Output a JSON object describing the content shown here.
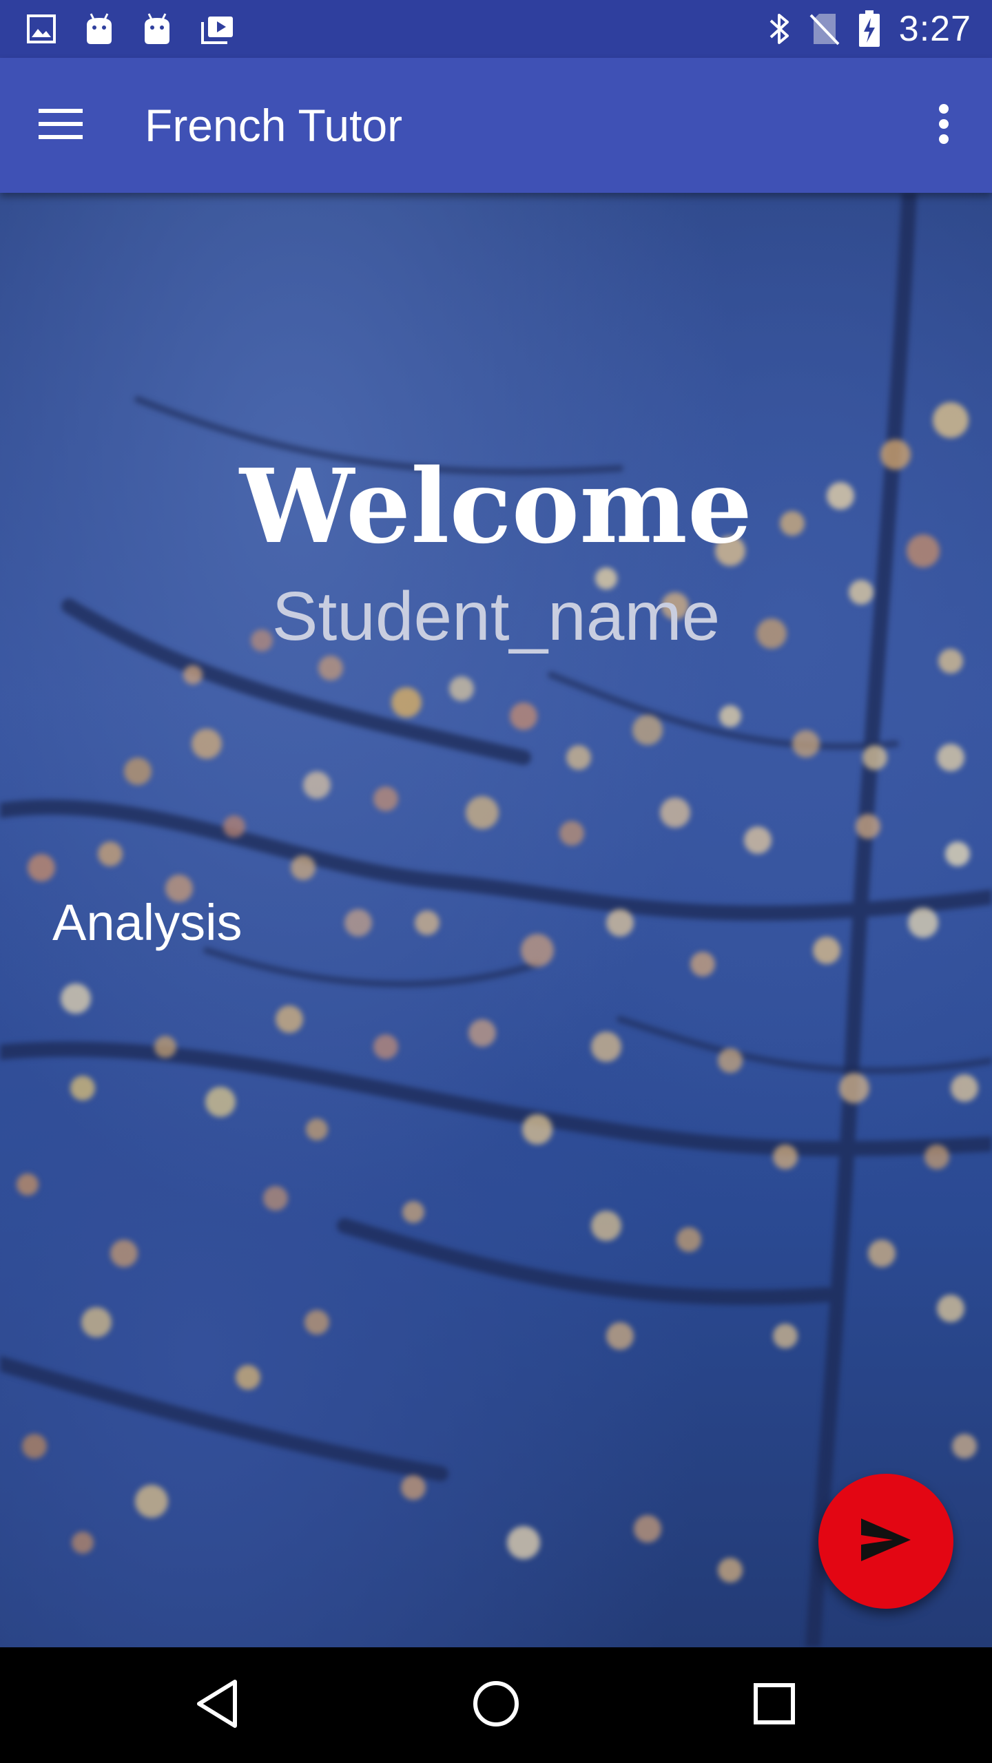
{
  "status_bar": {
    "time": "3:27",
    "left_icons": [
      "image-icon",
      "android-icon",
      "android-icon",
      "media-stack-icon"
    ],
    "right_icons": [
      "bluetooth-icon",
      "no-sim-icon",
      "battery-charging-icon"
    ]
  },
  "app_bar": {
    "title": "French Tutor",
    "menu_icon": "hamburger-menu-icon",
    "overflow_icon": "more-vert-icon",
    "color": "#3f51b5"
  },
  "main": {
    "welcome": "Welcome",
    "student_name": "Student_name",
    "analysis": "Analysis"
  },
  "fab": {
    "icon": "send-icon",
    "color": "#e30613"
  },
  "nav_bar": {
    "icons": [
      "back-icon",
      "home-icon",
      "recents-icon"
    ]
  }
}
